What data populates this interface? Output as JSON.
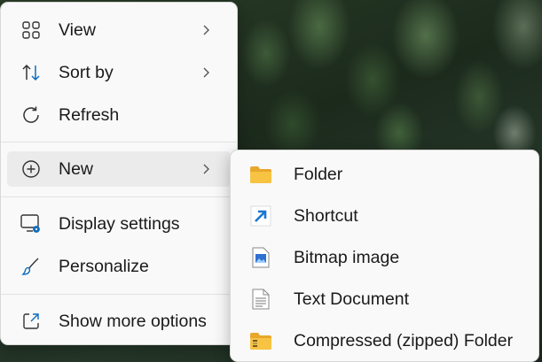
{
  "context_menu": {
    "items": [
      {
        "label": "View",
        "icon": "grid-view-icon",
        "has_submenu": true
      },
      {
        "label": "Sort by",
        "icon": "sort-arrows-icon",
        "has_submenu": true
      },
      {
        "label": "Refresh",
        "icon": "refresh-icon",
        "has_submenu": false
      },
      {
        "label": "New",
        "icon": "plus-circle-icon",
        "has_submenu": true,
        "active": true
      },
      {
        "label": "Display settings",
        "icon": "display-settings-icon",
        "has_submenu": false
      },
      {
        "label": "Personalize",
        "icon": "paintbrush-icon",
        "has_submenu": false
      },
      {
        "label": "Show more options",
        "icon": "open-external-icon",
        "has_submenu": false
      }
    ]
  },
  "new_submenu": {
    "items": [
      {
        "label": "Folder",
        "icon": "folder-icon"
      },
      {
        "label": "Shortcut",
        "icon": "shortcut-arrow-icon"
      },
      {
        "label": "Bitmap image",
        "icon": "bitmap-image-icon"
      },
      {
        "label": "Text Document",
        "icon": "text-document-icon"
      },
      {
        "label": "Compressed (zipped) Folder",
        "icon": "zipped-folder-icon"
      }
    ]
  },
  "colors": {
    "menu_bg": "#f9f9f9",
    "active_bg": "#ebebeb",
    "accent_blue": "#0f6cbd",
    "folder_yellow": "#f6c342"
  }
}
